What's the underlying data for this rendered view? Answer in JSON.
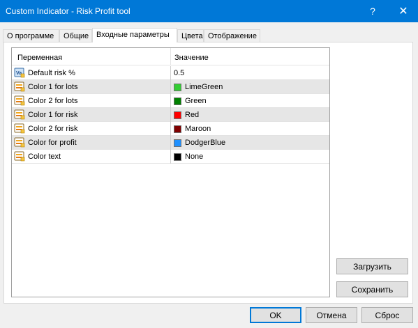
{
  "window": {
    "title": "Custom Indicator - Risk Profit tool",
    "help_glyph": "?",
    "close_glyph": "✕"
  },
  "tabs": [
    {
      "label": "О программе"
    },
    {
      "label": "Общие"
    },
    {
      "label": "Входные параметры"
    },
    {
      "label": "Цвета"
    },
    {
      "label": "Отображение"
    }
  ],
  "grid": {
    "col_variable": "Переменная",
    "col_value": "Значение",
    "rows": [
      {
        "name": "Default risk %",
        "value": "0.5",
        "icon": "value-icon"
      },
      {
        "name": "Color 1 for lots",
        "value": "LimeGreen",
        "color": "#32cd32",
        "icon": "color-param-icon"
      },
      {
        "name": "Color 2 for lots",
        "value": "Green",
        "color": "#008000",
        "icon": "color-param-icon"
      },
      {
        "name": "Color 1 for risk",
        "value": "Red",
        "color": "#ff0000",
        "icon": "color-param-icon"
      },
      {
        "name": "Color 2 for risk",
        "value": "Maroon",
        "color": "#800000",
        "icon": "color-param-icon"
      },
      {
        "name": "Color for profit",
        "value": "DodgerBlue",
        "color": "#1e90ff",
        "icon": "color-param-icon"
      },
      {
        "name": "Color text",
        "value": "None",
        "color": "#000000",
        "icon": "color-param-icon"
      }
    ]
  },
  "side_buttons": {
    "load": "Загрузить",
    "save": "Сохранить"
  },
  "footer_buttons": {
    "ok": "OK",
    "cancel": "Отмена",
    "reset": "Сброс"
  },
  "colors": {
    "titlebar": "#0078d7",
    "alt_row": "#e6e6e6"
  }
}
